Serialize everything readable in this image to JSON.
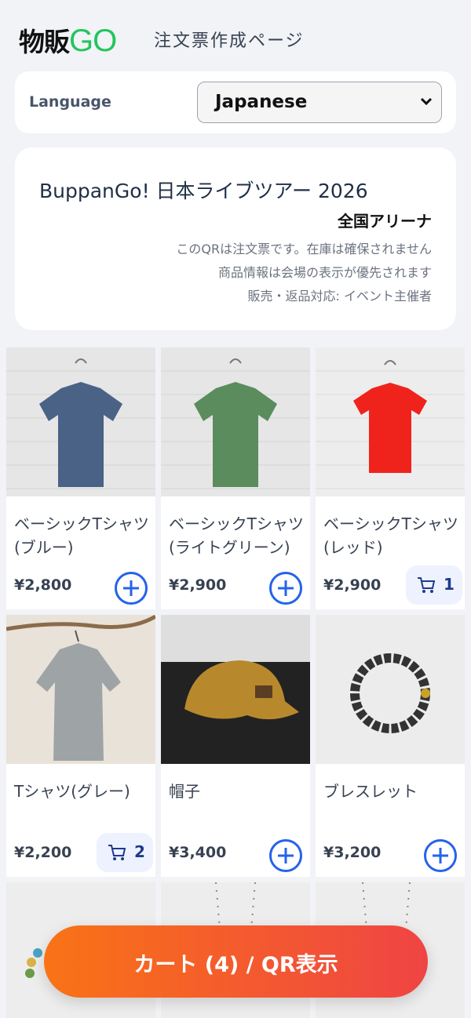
{
  "header": {
    "logo_jp": "物販",
    "logo_go": "GO",
    "page_title": "注文票作成ページ"
  },
  "language": {
    "label": "Language",
    "selected": "Japanese"
  },
  "event": {
    "title": "BuppanGo! 日本ライブツアー 2026",
    "venue": "全国アリーナ",
    "notes": [
      "このQRは注文票です。在庫は確保されません",
      "商品情報は会場の表示が優先されます",
      "販売・返品対応: イベント主催者"
    ]
  },
  "products": [
    {
      "name_line1": "ベーシックTシャツ",
      "name_line2": "(ブルー)",
      "price": "¥2,800",
      "cart_qty": null,
      "shirt_color": "#4a6285"
    },
    {
      "name_line1": "ベーシックTシャツ",
      "name_line2": "(ライトグリーン)",
      "price": "¥2,900",
      "cart_qty": null,
      "shirt_color": "#5a8c5e"
    },
    {
      "name_line1": "ベーシックTシャツ",
      "name_line2": "(レッド)",
      "price": "¥2,900",
      "cart_qty": "1",
      "shirt_color": "#f0231c"
    },
    {
      "name_line1": "Tシャツ(グレー)",
      "name_line2": "",
      "price": "¥2,200",
      "cart_qty": "2",
      "shirt_color": "#9ea3a6"
    },
    {
      "name_line1": "帽子",
      "name_line2": "",
      "price": "¥3,400",
      "cart_qty": null,
      "shirt_color": "#b8892c"
    },
    {
      "name_line1": "ブレスレット",
      "name_line2": "",
      "price": "¥3,200",
      "cart_qty": null,
      "shirt_color": "#333333"
    }
  ],
  "cta": {
    "label": "カート (4) / QR表示"
  },
  "colors": {
    "accent_green": "#22c55e",
    "accent_blue": "#2563eb",
    "cta_start": "#f97316",
    "cta_end": "#ef4444"
  }
}
